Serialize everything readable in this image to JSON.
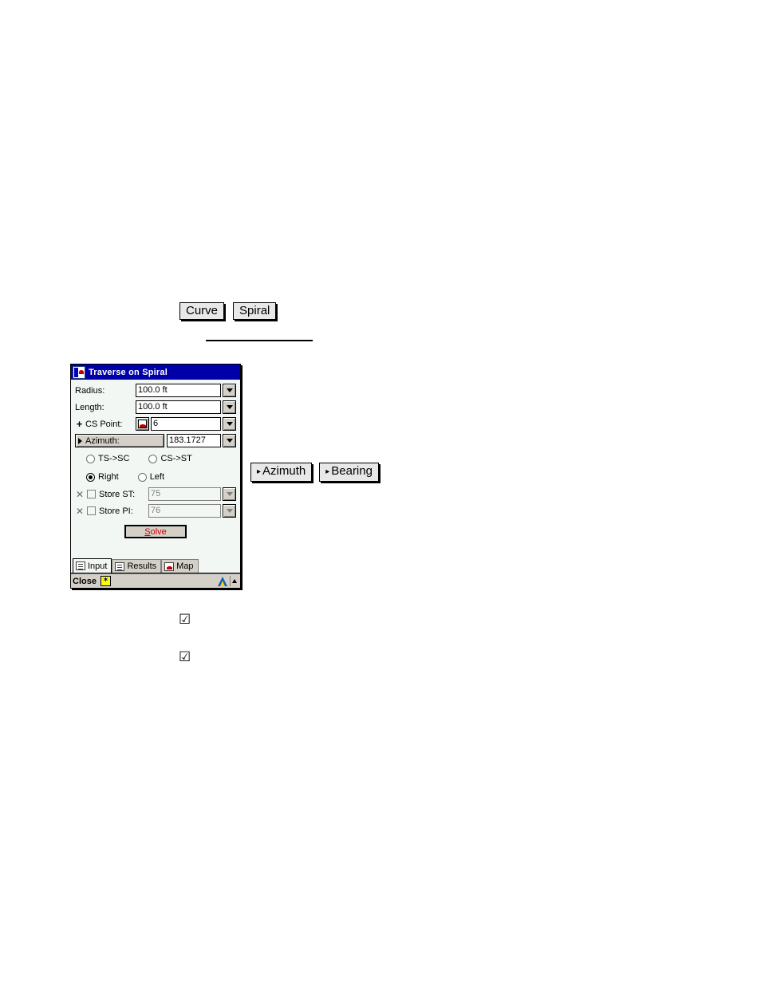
{
  "document": {
    "top_buttons": [
      {
        "label": "Curve",
        "arrow": false
      },
      {
        "label": "Spiral",
        "arrow": false
      }
    ],
    "mid_buttons": [
      {
        "label": "Azimuth",
        "arrow": true
      },
      {
        "label": "Bearing",
        "arrow": true
      }
    ],
    "checkbox_marks": [
      {
        "glyph": "☑"
      },
      {
        "glyph": "☑"
      }
    ],
    "arrow_glyph": "▸"
  },
  "dialog": {
    "title": "Traverse on Spiral",
    "title_icon": "map-window-icon",
    "fields": [
      {
        "label": "Radius:",
        "value": "100.0 ft",
        "disabled": false
      },
      {
        "label": "Length:",
        "value": "100.0 ft",
        "disabled": false
      }
    ],
    "cs_point": {
      "label": "CS Point:",
      "plus": "+",
      "picker_icon": "point-picker-icon",
      "value": "6"
    },
    "azimuth": {
      "button_label": "Azimuth:",
      "value": "183.1727"
    },
    "radios": [
      {
        "label": "TS->SC",
        "selected": false
      },
      {
        "label": "CS->ST",
        "selected": false
      },
      {
        "label": "Right",
        "selected": true
      },
      {
        "label": "Left",
        "selected": false
      }
    ],
    "stores": [
      {
        "label": "Store ST:",
        "value": "75",
        "checked": false,
        "disabled": true
      },
      {
        "label": "Store PI:",
        "value": "76",
        "checked": false,
        "disabled": true
      }
    ],
    "solve": {
      "accel": "S",
      "rest": "olve",
      "color": "#d00000"
    },
    "tabs": [
      {
        "label": "Input",
        "active": true,
        "icon": "form-icon"
      },
      {
        "label": "Results",
        "active": false,
        "icon": "list-icon"
      },
      {
        "label": "Map",
        "active": false,
        "icon": "map-icon"
      }
    ],
    "statusbar": {
      "close_label": "Close",
      "close_icon": "star-icon",
      "right_icons": [
        "survey-triangle-icon",
        "scroll-up-icon"
      ]
    },
    "colors": {
      "titlebar": "#0000a8",
      "window_bg": "#f2f7f4",
      "chrome": "#d4d0c8",
      "solve_text": "#d00000"
    }
  }
}
